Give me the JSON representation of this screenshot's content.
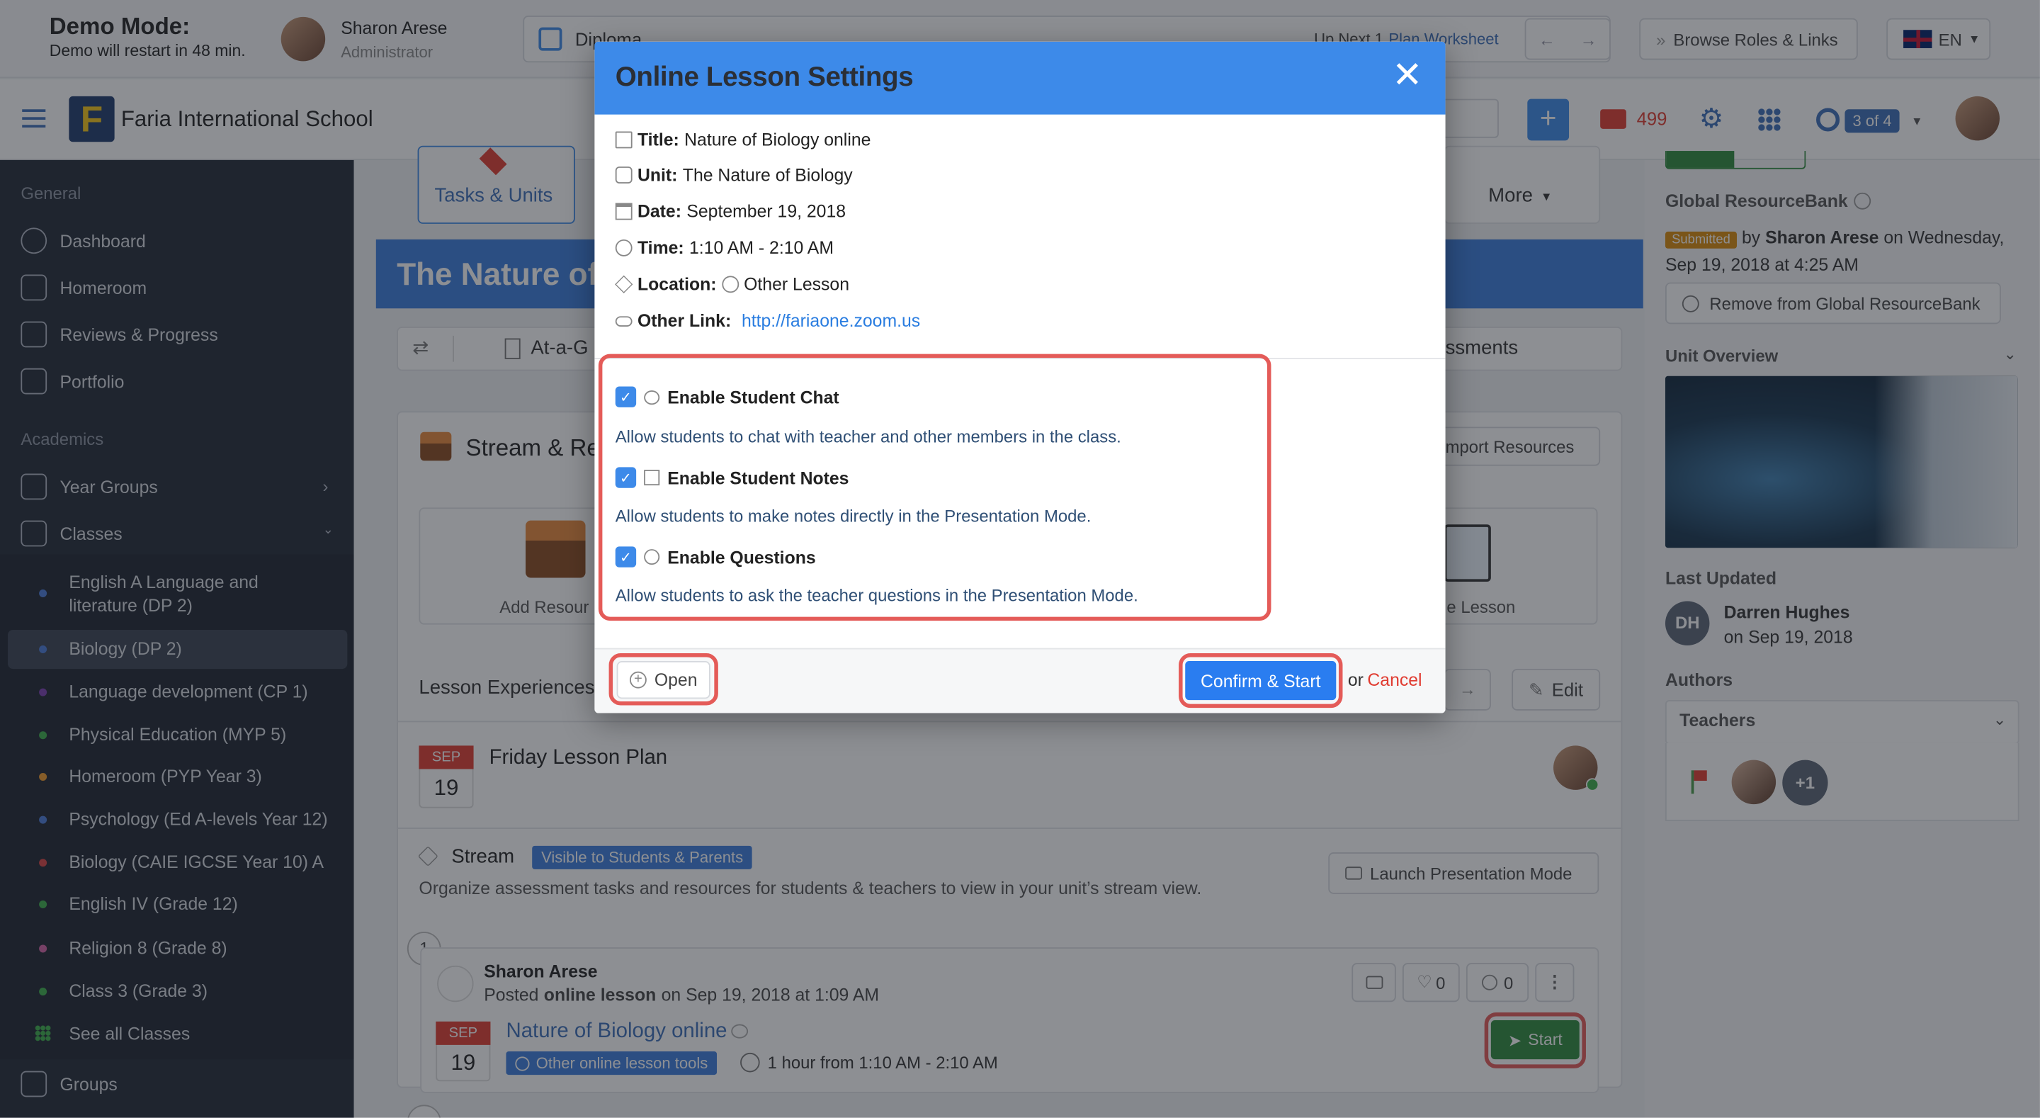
{
  "demo": {
    "title": "Demo Mode:",
    "subtitle": "Demo will restart in 48 min."
  },
  "user": {
    "name": "Sharon Arese",
    "role": "Administrator"
  },
  "crumb": {
    "program": "Diploma",
    "up_next_label": "Up Next 1",
    "up_next_item": "Plan Worksheet"
  },
  "top_actions": {
    "browse": "Browse Roles & Links",
    "lang": "EN"
  },
  "school": {
    "name": "Faria International School"
  },
  "header_badges": {
    "mail_count": "499",
    "pager": "3 of 4"
  },
  "sidebar": {
    "general_label": "General",
    "general": [
      "Dashboard",
      "Homeroom",
      "Reviews & Progress",
      "Portfolio"
    ],
    "academics_label": "Academics",
    "year_groups": "Year Groups",
    "classes": "Classes",
    "class_list": [
      {
        "label": "English A Language and literature (DP 2)",
        "color": "#4a7bd8"
      },
      {
        "label": "Biology (DP 2)",
        "color": "#4a7bd8"
      },
      {
        "label": "Language development (CP 1)",
        "color": "#7a3fb0"
      },
      {
        "label": "Physical Education (MYP 5)",
        "color": "#3cae4a"
      },
      {
        "label": "Homeroom (PYP Year 3)",
        "color": "#f09a2a"
      },
      {
        "label": "Psychology (Ed A-levels Year 12)",
        "color": "#4a7bd8"
      },
      {
        "label": "Biology (CAIE IGCSE Year 10) A",
        "color": "#d94343"
      },
      {
        "label": "English IV (Grade 12)",
        "color": "#3cae4a"
      },
      {
        "label": "Religion 8 (Grade 8)",
        "color": "#d062a5"
      },
      {
        "label": "Class 3 (Grade 3)",
        "color": "#3cae4a"
      }
    ],
    "see_all": "See all Classes",
    "groups": "Groups"
  },
  "main": {
    "tab_tasks": "Tasks & Units",
    "tab_more": "More",
    "banner_title": "The Nature of",
    "subbar_left": "At-a-G",
    "subbar_right": "ssments",
    "stream_title": "Stream & Re",
    "import_btn": "mport Resources",
    "add_resource": "Add Resour",
    "lesson_tile": "e Lesson",
    "lesson_exp": "Lesson Experiences",
    "edit": "Edit",
    "plan_month": "SEP",
    "plan_day": "19",
    "plan_title": "Friday Lesson Plan",
    "stream_label": "Stream",
    "visibility": "Visible to Students & Parents",
    "launch": "Launch Presentation Mode",
    "stream_desc": "Organize assessment tasks and resources for students & teachers to view in your unit’s stream view.",
    "post_num": "1",
    "post_author": "Sharon Arese",
    "post_verb": "Posted",
    "post_kind": "online lesson",
    "post_date": "on Sep 19, 2018 at 1:09 AM",
    "likes": "0",
    "comments": "0",
    "post_month": "SEP",
    "post_day": "19",
    "post_title": "Nature of Biology online",
    "post_tag": "Other online lesson tools",
    "post_time": "1 hour from 1:10 AM - 2:10 AM",
    "start": "Start"
  },
  "right": {
    "bank_title": "Global ResourceBank",
    "submitted": "Submitted",
    "by": "by",
    "by_name": "Sharon Arese",
    "by_date": "on Wednesday, Sep 19, 2018 at 4:25 AM",
    "remove": "Remove from Global ResourceBank",
    "unit_overview": "Unit Overview",
    "last_updated": "Last Updated",
    "updater_initials": "DH",
    "updater_name": "Darren Hughes",
    "updater_date": "on Sep 19, 2018",
    "authors": "Authors",
    "teachers": "Teachers",
    "plus": "+1"
  },
  "modal": {
    "title": "Online Lesson Settings",
    "rows": [
      {
        "label": "Title:",
        "value": "Nature of Biology online"
      },
      {
        "label": "Unit:",
        "value": "The Nature of Biology"
      },
      {
        "label": "Date:",
        "value": "September 19, 2018"
      },
      {
        "label": "Time:",
        "value": "1:10 AM - 2:10 AM"
      },
      {
        "label": "Location:",
        "value": "Other Lesson"
      },
      {
        "label": "Other Link:",
        "value": "http://fariaone.zoom.us"
      }
    ],
    "options": [
      {
        "label": "Enable Student Chat",
        "desc": "Allow students to chat with teacher and other members in the class.",
        "checked": true
      },
      {
        "label": "Enable Student Notes",
        "desc": "Allow students to make notes directly in the Presentation Mode.",
        "checked": true
      },
      {
        "label": "Enable Questions",
        "desc": "Allow students to ask the teacher questions in the Presentation Mode.",
        "checked": true
      }
    ],
    "open": "Open",
    "confirm": "Confirm & Start",
    "or": "or",
    "cancel": "Cancel"
  },
  "colors": {
    "primary": "#3d8ae9",
    "highlight": "#e45b58",
    "sidebar": "#232a36",
    "success": "#2e8b3d",
    "danger": "#e03c31"
  }
}
